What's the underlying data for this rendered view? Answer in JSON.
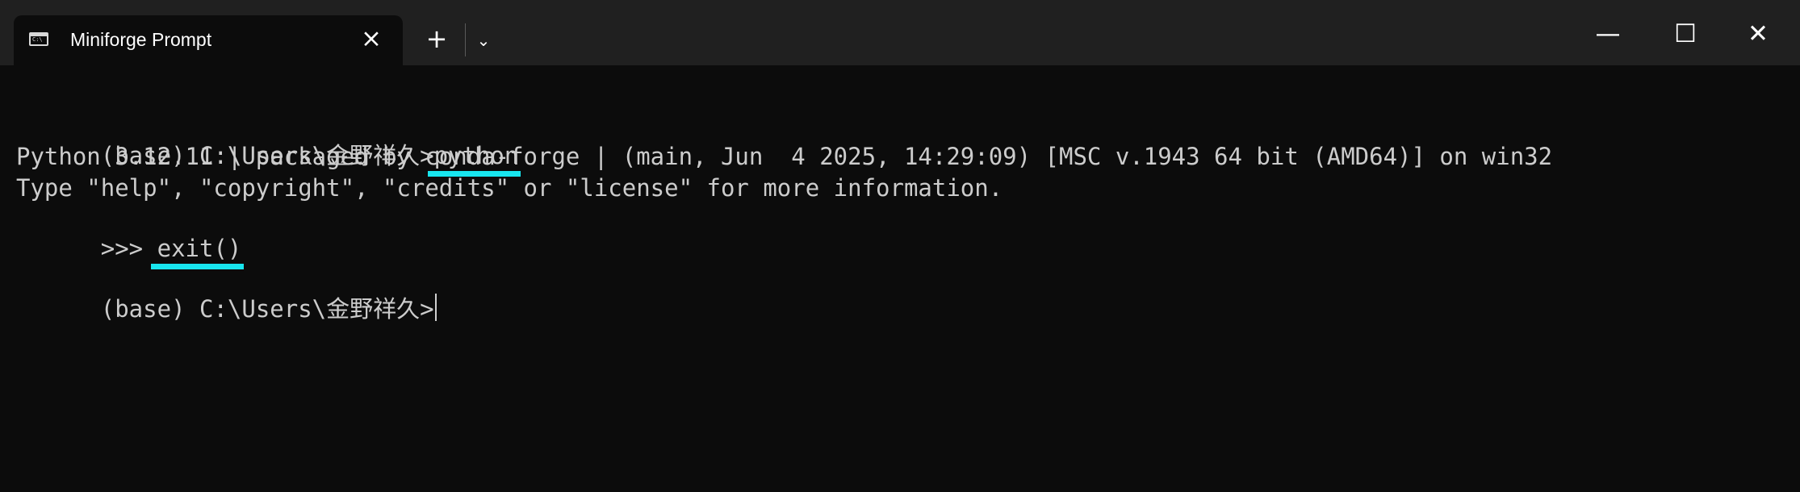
{
  "window": {
    "tab_title": "Miniforge Prompt",
    "tab_icon": "terminal-icon",
    "tab_close": "×",
    "new_tab": "+",
    "dropdown": "⌄",
    "minimize": "—",
    "maximize": "☐",
    "close": "✕"
  },
  "terminal": {
    "prompt_1": "(base) C:\\Users\\金野祥久>",
    "command_1": "python",
    "python_version_line": "Python 3.12.11 | packaged by conda-forge | (main, Jun  4 2025, 14:29:09) [MSC v.1943 64 bit (AMD64)] on win32",
    "info_line": "Type \"help\", \"copyright\", \"credits\" or \"license\" for more information.",
    "python_prompt": ">>> ",
    "command_2": "exit()",
    "prompt_2": "(base) C:\\Users\\金野祥久>"
  },
  "colors": {
    "terminal_background": "#0c0c0c",
    "titlebar_background": "#202020",
    "text": "#cccccc",
    "underline_highlight": "#18e6ef"
  }
}
